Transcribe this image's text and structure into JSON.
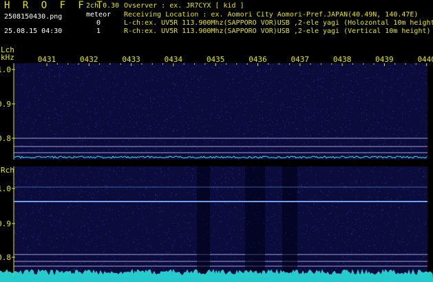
{
  "header": {
    "app_title": "H R O F F T",
    "filename": "2508150430.png",
    "datetime": "25.08.15 04:30",
    "mode": "2ch 0.30",
    "meteor_label": "meteor",
    "l_meteor_count": "0",
    "r_meteor_count": "1"
  },
  "info": {
    "observer": "Ovserver                : ex. JR7CYX [ kid ]",
    "location": "Receiving Location : ex. Aomori City Aomori-Pref.JAPAN(40.49N, 140.47E)",
    "l_channel": "L-ch:ex. UV5R 113.900Mhz(SAPPORO VOR)USB ,2-ele yagi (Holozontal 10m height)",
    "r_channel": "R-ch:ex. UV5R 113.900Mhz(SAPPORO VOR)USB ,2-ele yagi (Vertical 10m height)"
  },
  "axes": {
    "lch_label": "Lch",
    "khz_label": "kHz",
    "rch_label": "Rch",
    "time_ticks": [
      "0431",
      "0432",
      "0433",
      "0434",
      "0435",
      "0436",
      "0437",
      "0438",
      "0439",
      "0440"
    ],
    "freq_ticks": [
      "1.0",
      "0.9",
      "0.8"
    ]
  },
  "colors": {
    "text_yellow": "#e8e800",
    "spectrogram_bg": "#0b0b3c",
    "noise": "#2a3aa0",
    "signal": "#7fb0ff",
    "level_cyan": "#2be0e0"
  }
}
